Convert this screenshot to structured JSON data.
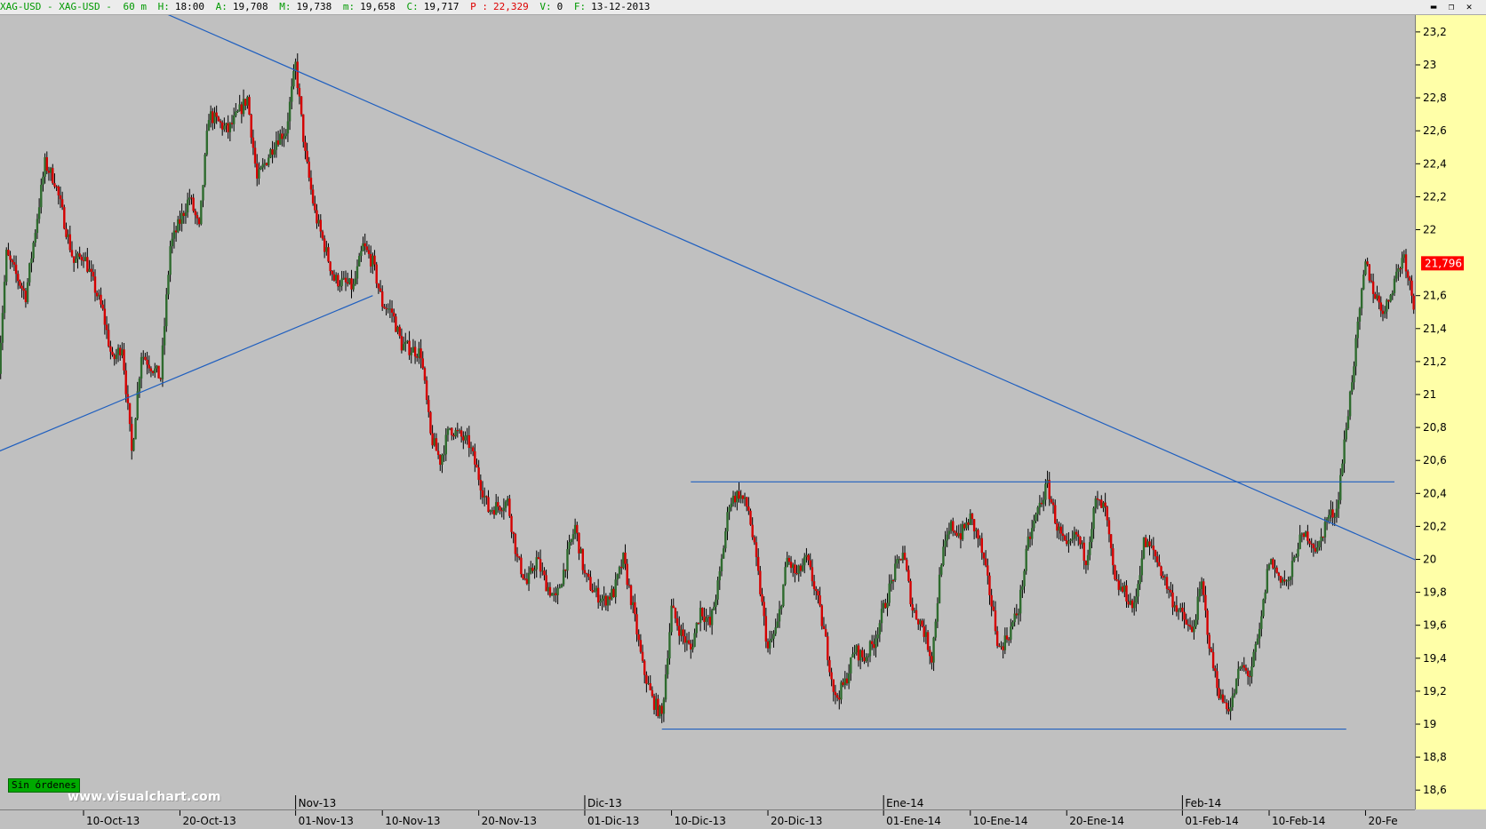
{
  "header": {
    "symbol": "XAG-USD - XAG-USD -",
    "interval": "60 m",
    "h_label": "H:",
    "h_value": "18:00",
    "a_label": "A:",
    "a_value": "19,708",
    "m_label": "M:",
    "m_value": "19,738",
    "min_label": "m:",
    "min_value": "19,658",
    "c_label": "C:",
    "c_value": "19,717",
    "p_label": "P :",
    "p_value": "22,329",
    "v_label": "V:",
    "v_value": "0",
    "f_label": "F:",
    "f_value": "13-12-2013"
  },
  "window_controls": {
    "minimize": "▬",
    "restore": "❐",
    "close": "✕"
  },
  "status": {
    "orders_badge": "Sin órdenes",
    "watermark": "www.visualchart.com"
  },
  "colors": {
    "up": "#2e6b2e",
    "down": "#d40000",
    "wick": "#000000",
    "trendline": "#1f5fbf",
    "current_price_bg": "#ff0000"
  },
  "chart_data": {
    "type": "candlestick",
    "ylim": [
      18.5,
      23.3
    ],
    "y_ticks": [
      {
        "label": "23,2",
        "value": 23.2
      },
      {
        "label": "23",
        "value": 23.0
      },
      {
        "label": "22,8",
        "value": 22.8
      },
      {
        "label": "22,6",
        "value": 22.6
      },
      {
        "label": "22,4",
        "value": 22.4
      },
      {
        "label": "22,2",
        "value": 22.2
      },
      {
        "label": "22",
        "value": 22.0
      },
      {
        "label": "21,6",
        "value": 21.6
      },
      {
        "label": "21,4",
        "value": 21.4
      },
      {
        "label": "21,2",
        "value": 21.2
      },
      {
        "label": "21",
        "value": 21.0
      },
      {
        "label": "20,8",
        "value": 20.8
      },
      {
        "label": "20,6",
        "value": 20.6
      },
      {
        "label": "20,4",
        "value": 20.4
      },
      {
        "label": "20,2",
        "value": 20.2
      },
      {
        "label": "20",
        "value": 20.0
      },
      {
        "label": "19,8",
        "value": 19.8
      },
      {
        "label": "19,6",
        "value": 19.6
      },
      {
        "label": "19,4",
        "value": 19.4
      },
      {
        "label": "19,2",
        "value": 19.2
      },
      {
        "label": "19",
        "value": 19.0
      },
      {
        "label": "18,8",
        "value": 18.8
      },
      {
        "label": "18,6",
        "value": 18.6
      }
    ],
    "current_price": {
      "label": "21,796",
      "value": 21.796
    },
    "x_ticks": [
      {
        "label": "10-Oct-13",
        "date": "2013-10-10"
      },
      {
        "label": "20-Oct-13",
        "date": "2013-10-20"
      },
      {
        "label": "01-Nov-13",
        "date": "2013-11-01",
        "month": "Nov-13"
      },
      {
        "label": "10-Nov-13",
        "date": "2013-11-10"
      },
      {
        "label": "20-Nov-13",
        "date": "2013-11-20"
      },
      {
        "label": "01-Dic-13",
        "date": "2013-12-01",
        "month": "Dic-13"
      },
      {
        "label": "10-Dic-13",
        "date": "2013-12-10"
      },
      {
        "label": "20-Dic-13",
        "date": "2013-12-20"
      },
      {
        "label": "01-Ene-14",
        "date": "2014-01-01",
        "month": "Ene-14"
      },
      {
        "label": "10-Ene-14",
        "date": "2014-01-10"
      },
      {
        "label": "20-Ene-14",
        "date": "2014-01-20"
      },
      {
        "label": "01-Feb-14",
        "date": "2014-02-01",
        "month": "Feb-14"
      },
      {
        "label": "10-Feb-14",
        "date": "2014-02-10"
      },
      {
        "label": "20-Fe",
        "date": "2014-02-20"
      }
    ],
    "price_path": [
      [
        "2013-10-01",
        21.0
      ],
      [
        "2013-10-02",
        21.85
      ],
      [
        "2013-10-04",
        21.6
      ],
      [
        "2013-10-06",
        22.4
      ],
      [
        "2013-10-07",
        22.3
      ],
      [
        "2013-10-09",
        21.8
      ],
      [
        "2013-10-10",
        21.85
      ],
      [
        "2013-10-12",
        21.5
      ],
      [
        "2013-10-13",
        21.2
      ],
      [
        "2013-10-14",
        21.3
      ],
      [
        "2013-10-15",
        20.65
      ],
      [
        "2013-10-16",
        21.25
      ],
      [
        "2013-10-18",
        21.1
      ],
      [
        "2013-10-19",
        21.9
      ],
      [
        "2013-10-21",
        22.2
      ],
      [
        "2013-10-22",
        22.0
      ],
      [
        "2013-10-23",
        22.7
      ],
      [
        "2013-10-25",
        22.6
      ],
      [
        "2013-10-27",
        22.8
      ],
      [
        "2013-10-28",
        22.3
      ],
      [
        "2013-10-30",
        22.55
      ],
      [
        "2013-10-31",
        22.6
      ],
      [
        "2013-11-01",
        23.0
      ],
      [
        "2013-11-02",
        22.45
      ],
      [
        "2013-11-03",
        22.1
      ],
      [
        "2013-11-04",
        21.9
      ],
      [
        "2013-11-05",
        21.7
      ],
      [
        "2013-11-07",
        21.65
      ],
      [
        "2013-11-08",
        21.9
      ],
      [
        "2013-11-09",
        21.8
      ],
      [
        "2013-11-10",
        21.55
      ],
      [
        "2013-11-11",
        21.5
      ],
      [
        "2013-11-12",
        21.3
      ],
      [
        "2013-11-14",
        21.25
      ],
      [
        "2013-11-15",
        20.75
      ],
      [
        "2013-11-16",
        20.6
      ],
      [
        "2013-11-17",
        20.8
      ],
      [
        "2013-11-19",
        20.7
      ],
      [
        "2013-11-20",
        20.5
      ],
      [
        "2013-11-21",
        20.3
      ],
      [
        "2013-11-23",
        20.35
      ],
      [
        "2013-11-24",
        20.0
      ],
      [
        "2013-11-25",
        19.85
      ],
      [
        "2013-11-26",
        20.0
      ],
      [
        "2013-11-27",
        19.85
      ],
      [
        "2013-11-28",
        19.75
      ],
      [
        "2013-11-30",
        20.2
      ],
      [
        "2013-12-01",
        19.9
      ],
      [
        "2013-12-02",
        19.8
      ],
      [
        "2013-12-03",
        19.75
      ],
      [
        "2013-12-04",
        19.8
      ],
      [
        "2013-12-05",
        20.0
      ],
      [
        "2013-12-06",
        19.7
      ],
      [
        "2013-12-07",
        19.35
      ],
      [
        "2013-12-08",
        19.15
      ],
      [
        "2013-12-09",
        19.05
      ],
      [
        "2013-12-10",
        19.7
      ],
      [
        "2013-12-11",
        19.55
      ],
      [
        "2013-12-12",
        19.45
      ],
      [
        "2013-12-13",
        19.7
      ],
      [
        "2013-12-14",
        19.6
      ],
      [
        "2013-12-15",
        19.9
      ],
      [
        "2013-12-16",
        20.35
      ],
      [
        "2013-12-17",
        20.4
      ],
      [
        "2013-12-18",
        20.3
      ],
      [
        "2013-12-19",
        19.9
      ],
      [
        "2013-12-20",
        19.45
      ],
      [
        "2013-12-21",
        19.6
      ],
      [
        "2013-12-22",
        20.0
      ],
      [
        "2013-12-23",
        19.9
      ],
      [
        "2013-12-24",
        20.0
      ],
      [
        "2013-12-25",
        19.8
      ],
      [
        "2013-12-26",
        19.5
      ],
      [
        "2013-12-27",
        19.15
      ],
      [
        "2013-12-28",
        19.25
      ],
      [
        "2013-12-29",
        19.45
      ],
      [
        "2013-12-30",
        19.4
      ],
      [
        "2013-12-31",
        19.5
      ],
      [
        "2014-01-01",
        19.7
      ],
      [
        "2014-01-02",
        19.9
      ],
      [
        "2014-01-03",
        20.05
      ],
      [
        "2014-01-04",
        19.7
      ],
      [
        "2014-01-05",
        19.6
      ],
      [
        "2014-01-06",
        19.4
      ],
      [
        "2014-01-07",
        20.0
      ],
      [
        "2014-01-08",
        20.2
      ],
      [
        "2014-01-09",
        20.15
      ],
      [
        "2014-01-10",
        20.25
      ],
      [
        "2014-01-11",
        20.1
      ],
      [
        "2014-01-12",
        19.8
      ],
      [
        "2014-01-13",
        19.45
      ],
      [
        "2014-01-14",
        19.55
      ],
      [
        "2014-01-15",
        19.7
      ],
      [
        "2014-01-16",
        20.1
      ],
      [
        "2014-01-17",
        20.3
      ],
      [
        "2014-01-18",
        20.45
      ],
      [
        "2014-01-19",
        20.2
      ],
      [
        "2014-01-20",
        20.05
      ],
      [
        "2014-01-21",
        20.15
      ],
      [
        "2014-01-22",
        20.0
      ],
      [
        "2014-01-23",
        20.35
      ],
      [
        "2014-01-24",
        20.3
      ],
      [
        "2014-01-25",
        19.85
      ],
      [
        "2014-01-26",
        19.8
      ],
      [
        "2014-01-27",
        19.7
      ],
      [
        "2014-01-28",
        20.1
      ],
      [
        "2014-01-29",
        20.05
      ],
      [
        "2014-01-30",
        19.9
      ],
      [
        "2014-01-31",
        19.75
      ],
      [
        "2014-02-01",
        19.65
      ],
      [
        "2014-02-02",
        19.55
      ],
      [
        "2014-02-03",
        19.85
      ],
      [
        "2014-02-04",
        19.4
      ],
      [
        "2014-02-05",
        19.15
      ],
      [
        "2014-02-06",
        19.1
      ],
      [
        "2014-02-07",
        19.35
      ],
      [
        "2014-02-08",
        19.3
      ],
      [
        "2014-02-09",
        19.55
      ],
      [
        "2014-02-10",
        20.0
      ],
      [
        "2014-02-11",
        19.9
      ],
      [
        "2014-02-12",
        19.85
      ],
      [
        "2014-02-13",
        20.1
      ],
      [
        "2014-02-14",
        20.15
      ],
      [
        "2014-02-15",
        20.05
      ],
      [
        "2014-02-16",
        20.25
      ],
      [
        "2014-02-17",
        20.3
      ],
      [
        "2014-02-18",
        20.8
      ],
      [
        "2014-02-19",
        21.3
      ],
      [
        "2014-02-20",
        21.8
      ],
      [
        "2014-02-21",
        21.6
      ],
      [
        "2014-02-22",
        21.5
      ],
      [
        "2014-02-23",
        21.7
      ],
      [
        "2014-02-24",
        21.85
      ],
      [
        "2014-02-25",
        21.55
      ],
      [
        "2014-02-26",
        21.7
      ],
      [
        "2014-02-27",
        21.8
      ]
    ],
    "trendlines": [
      {
        "name": "resistance-diagonal",
        "from": [
          "2013-10-17",
          23.35
        ],
        "to": [
          "2014-02-27",
          19.95
        ]
      },
      {
        "name": "support-rising",
        "from": [
          "2013-10-01",
          20.65
        ],
        "to": [
          "2013-11-09",
          21.6
        ]
      },
      {
        "name": "range-top",
        "from": [
          "2013-12-12",
          20.47
        ],
        "to": [
          "2014-02-23",
          20.47
        ]
      },
      {
        "name": "range-bottom",
        "from": [
          "2013-12-09",
          18.97
        ],
        "to": [
          "2014-02-18",
          18.97
        ]
      }
    ]
  }
}
